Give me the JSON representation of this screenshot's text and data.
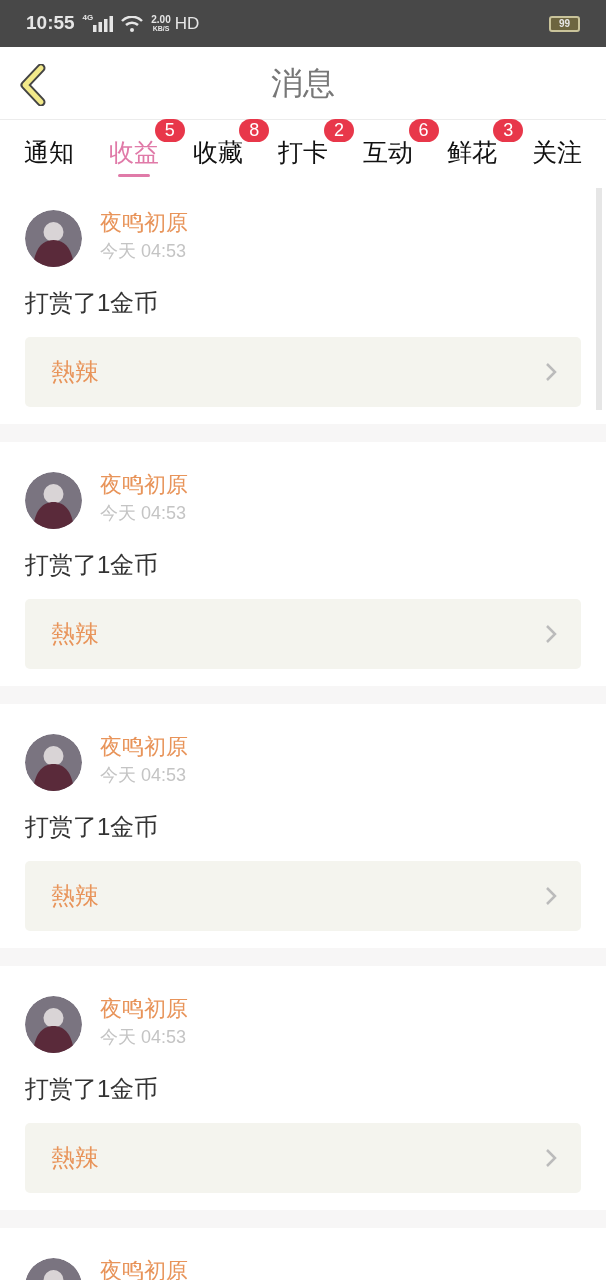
{
  "status_bar": {
    "time": "10:55",
    "network": "4G",
    "speed": "2.00",
    "speed_unit": "KB/S",
    "hd": "HD",
    "battery": "99"
  },
  "header": {
    "title": "消息"
  },
  "tabs": [
    {
      "label": "通知",
      "selected": false
    },
    {
      "label": "收益",
      "selected": true,
      "badge": "5"
    },
    {
      "label": "收藏",
      "selected": false,
      "badge": "8"
    },
    {
      "label": "打卡",
      "selected": false,
      "badge": "2"
    },
    {
      "label": "互动",
      "selected": false,
      "badge": "6"
    },
    {
      "label": "鲜花",
      "selected": false,
      "badge": "3"
    },
    {
      "label": "关注",
      "selected": false
    }
  ],
  "messages": [
    {
      "name": "夜鸣初原",
      "time": "今天 04:53",
      "text": "打赏了1金币",
      "link": "熱辣"
    },
    {
      "name": "夜鸣初原",
      "time": "今天 04:53",
      "text": "打赏了1金币",
      "link": "熱辣"
    },
    {
      "name": "夜鸣初原",
      "time": "今天 04:53",
      "text": "打赏了1金币",
      "link": "熱辣"
    },
    {
      "name": "夜鸣初原",
      "time": "今天 04:53",
      "text": "打赏了1金币",
      "link": "熱辣"
    },
    {
      "name": "夜鸣初原"
    }
  ]
}
